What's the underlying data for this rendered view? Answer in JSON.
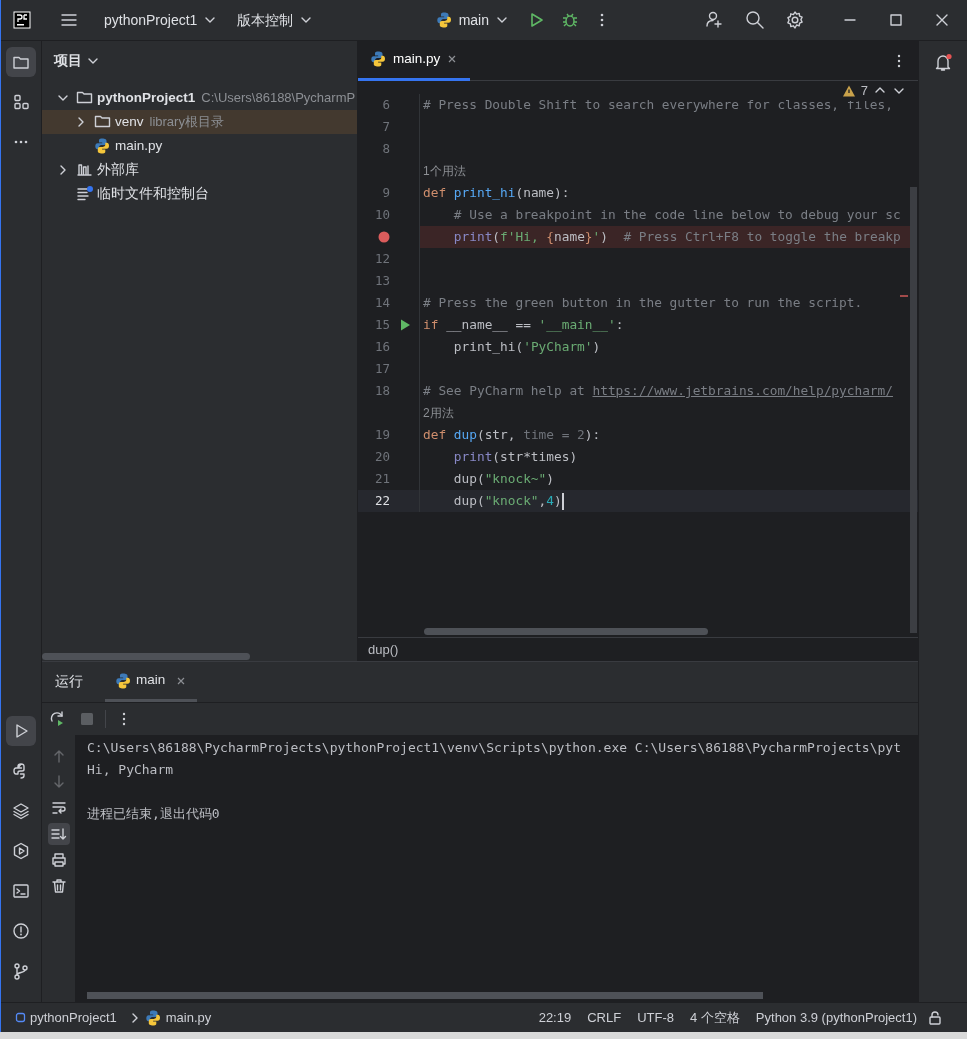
{
  "title_bar": {
    "project": "pythonProject1",
    "vcs": "版本控制",
    "run_config": "main"
  },
  "left_toolbar": {
    "top": [
      {
        "kind": "folder",
        "selected": true
      },
      {
        "kind": "structure",
        "selected": false
      },
      {
        "kind": "more",
        "selected": false
      }
    ],
    "bottom": [
      {
        "kind": "run",
        "selected": true
      },
      {
        "kind": "python",
        "selected": false
      },
      {
        "kind": "layers",
        "selected": false
      },
      {
        "kind": "services",
        "selected": false
      },
      {
        "kind": "terminal",
        "selected": false
      },
      {
        "kind": "problems",
        "selected": false
      },
      {
        "kind": "git",
        "selected": false
      }
    ]
  },
  "project_panel": {
    "title": "项目",
    "tree": [
      {
        "label": "pythonProject1",
        "kind": "folder",
        "hint": "C:\\Users\\86188\\PycharmP",
        "expanded": true,
        "selected": false,
        "children": [
          {
            "label": "venv",
            "kind": "folder",
            "hint": "library根目录",
            "expanded": false,
            "selected": true
          },
          {
            "label": "main.py",
            "kind": "python",
            "selected": false
          }
        ]
      },
      {
        "label": "外部库",
        "kind": "library",
        "expanded": false,
        "selected": false
      },
      {
        "label": "临时文件和控制台",
        "kind": "scratch",
        "selected": false
      }
    ]
  },
  "editor": {
    "tabs": [
      {
        "label": "main.py",
        "selected": true
      }
    ],
    "warnings": "7",
    "breadcrumb": "dup()",
    "lines": [
      {
        "kind": "code",
        "number": "6",
        "current": false,
        "breakpoint": false,
        "run_button": false,
        "tokens": [
          {
            "kind": "comment",
            "text": "# Press Double Shift to search everywhere for classes, files,"
          }
        ]
      },
      {
        "kind": "code",
        "number": "7",
        "current": false,
        "breakpoint": false,
        "run_button": false
      },
      {
        "kind": "code",
        "number": "8",
        "current": false,
        "breakpoint": false,
        "run_button": false
      },
      {
        "kind": "hint",
        "text": "1个用法"
      },
      {
        "kind": "code",
        "number": "9",
        "current": false,
        "breakpoint": false,
        "run_button": false,
        "tokens": [
          {
            "kind": "keyword",
            "text": "def "
          },
          {
            "kind": "function",
            "text": "print_hi"
          },
          {
            "kind": "plain",
            "text": "(name):"
          }
        ]
      },
      {
        "kind": "code",
        "number": "10",
        "current": false,
        "breakpoint": false,
        "run_button": false,
        "tokens": [
          {
            "kind": "comment",
            "text": "    # Use a breakpoint in the code line below to debug your sc"
          }
        ]
      },
      {
        "kind": "code",
        "current": false,
        "breakpoint": true,
        "run_button": false,
        "tokens": [
          {
            "kind": "builtin",
            "text": "    print"
          },
          {
            "kind": "plain",
            "text": "("
          },
          {
            "kind": "string",
            "text": "f'Hi, "
          },
          {
            "kind": "keyword",
            "text": "{"
          },
          {
            "kind": "plain",
            "text": "name"
          },
          {
            "kind": "keyword",
            "text": "}"
          },
          {
            "kind": "string",
            "text": "'"
          },
          {
            "kind": "plain",
            "text": ")  "
          },
          {
            "kind": "comment",
            "text": "# Press Ctrl+F8 to toggle the breakp"
          }
        ]
      },
      {
        "kind": "code",
        "number": "12",
        "current": false,
        "breakpoint": false,
        "run_button": false
      },
      {
        "kind": "code",
        "number": "13",
        "current": false,
        "breakpoint": false,
        "run_button": false
      },
      {
        "kind": "code",
        "number": "14",
        "current": false,
        "breakpoint": false,
        "run_button": false,
        "tokens": [
          {
            "kind": "comment",
            "text": "# Press the green button in the gutter to run the script."
          }
        ]
      },
      {
        "kind": "code",
        "number": "15",
        "current": false,
        "breakpoint": false,
        "run_button": true,
        "tokens": [
          {
            "kind": "keyword",
            "text": "if "
          },
          {
            "kind": "plain",
            "text": "__name__ == "
          },
          {
            "kind": "string",
            "text": "'__main__'"
          },
          {
            "kind": "plain",
            "text": ":"
          }
        ]
      },
      {
        "kind": "code",
        "number": "16",
        "current": false,
        "breakpoint": false,
        "run_button": false,
        "tokens": [
          {
            "kind": "plain",
            "text": "    print_hi("
          },
          {
            "kind": "string",
            "text": "'PyCharm'"
          },
          {
            "kind": "plain",
            "text": ")"
          }
        ]
      },
      {
        "kind": "code",
        "number": "17",
        "current": false,
        "breakpoint": false,
        "run_button": false
      },
      {
        "kind": "code",
        "number": "18",
        "current": false,
        "breakpoint": false,
        "run_button": false,
        "tokens": [
          {
            "kind": "comment",
            "text": "# See PyCharm help at "
          },
          {
            "kind": "link",
            "text": "https://www.jetbrains.com/help/pycharm/"
          }
        ]
      },
      {
        "kind": "hint",
        "text": "2用法"
      },
      {
        "kind": "code",
        "number": "19",
        "current": false,
        "breakpoint": false,
        "run_button": false,
        "tokens": [
          {
            "kind": "keyword",
            "text": "def "
          },
          {
            "kind": "function",
            "text": "dup"
          },
          {
            "kind": "plain",
            "text": "(str, "
          },
          {
            "kind": "dim",
            "text": "time = 2"
          },
          {
            "kind": "plain",
            "text": "):"
          }
        ]
      },
      {
        "kind": "code",
        "number": "20",
        "current": false,
        "breakpoint": false,
        "run_button": false,
        "tokens": [
          {
            "kind": "builtin",
            "text": "    print"
          },
          {
            "kind": "plain",
            "text": "(str*times)"
          }
        ]
      },
      {
        "kind": "code",
        "number": "21",
        "current": false,
        "breakpoint": false,
        "run_button": false,
        "tokens": [
          {
            "kind": "plain",
            "text": "    dup("
          },
          {
            "kind": "string",
            "text": "\"knock~\""
          },
          {
            "kind": "plain",
            "text": ")"
          }
        ]
      },
      {
        "kind": "code",
        "number": "22",
        "current": true,
        "breakpoint": false,
        "run_button": false,
        "tokens": [
          {
            "kind": "plain",
            "text": "    dup("
          },
          {
            "kind": "string",
            "text": "\"knock\""
          },
          {
            "kind": "plain",
            "text": ","
          },
          {
            "kind": "number",
            "text": "4"
          },
          {
            "kind": "plain",
            "text": ")"
          }
        ]
      }
    ]
  },
  "run_panel": {
    "title": "运行",
    "tabs": [
      {
        "label": "main",
        "selected": true
      }
    ],
    "side_tools": [
      {
        "kind": "up",
        "disabled": true,
        "selected": false
      },
      {
        "kind": "down",
        "disabled": true,
        "selected": false
      },
      {
        "kind": "wrap",
        "disabled": false,
        "selected": false
      },
      {
        "kind": "scroll_end",
        "disabled": false,
        "selected": true
      },
      {
        "kind": "print",
        "disabled": false,
        "selected": false
      },
      {
        "kind": "trash",
        "disabled": false,
        "selected": false
      }
    ],
    "output": [
      {
        "kind": "normal",
        "text": "C:\\Users\\86188\\PycharmProjects\\pythonProject1\\venv\\Scripts\\python.exe C:\\Users\\86188\\PycharmProjects\\pyt"
      },
      {
        "kind": "normal",
        "text": "Hi, PyCharm"
      },
      {
        "kind": "exit",
        "text": "进程已结束,退出代码0"
      }
    ]
  },
  "status_bar": {
    "breadcrumbs": [
      "pythonProject1",
      "main.py"
    ],
    "items": [
      "22:19",
      "CRLF",
      "UTF-8",
      "4 个空格",
      "Python 3.9 (pythonProject1)"
    ]
  }
}
